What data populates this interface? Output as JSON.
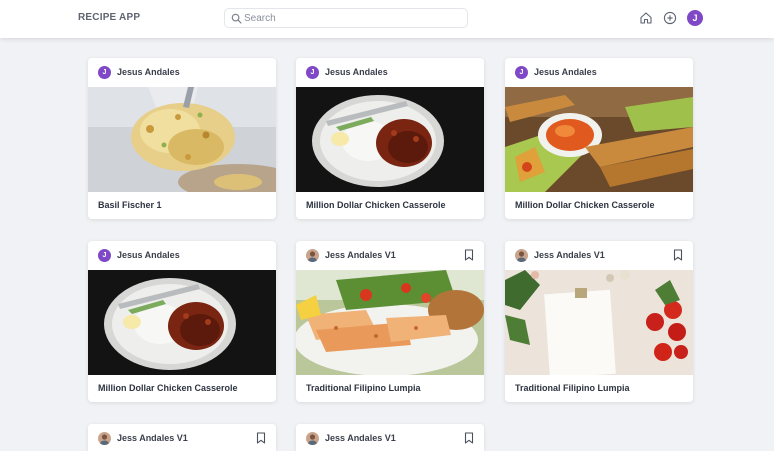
{
  "app": {
    "title": "RECIPE APP"
  },
  "search": {
    "placeholder": "Search",
    "value": ""
  },
  "nav": {
    "icons": [
      "home-icon",
      "add-circle-icon"
    ],
    "user_initial": "J"
  },
  "colors": {
    "accent": "#7f48c7",
    "background": "#f1f2f5",
    "card": "#ffffff",
    "text": "#2d3440"
  },
  "cards": [
    {
      "author": "Jesus Andales",
      "initial": "J",
      "title": "Basil Fischer 1",
      "bookmark": false,
      "image": "casserole-spoon"
    },
    {
      "author": "Jesus Andales",
      "initial": "J",
      "title": "Million Dollar Chicken Casserole",
      "bookmark": false,
      "image": "chicken-rice-plate"
    },
    {
      "author": "Jesus Andales",
      "initial": "J",
      "title": "Million Dollar Chicken Casserole",
      "bookmark": false,
      "image": "spring-rolls-dip"
    },
    {
      "author": "Jesus Andales",
      "initial": "J",
      "title": "Million Dollar Chicken Casserole",
      "bookmark": false,
      "image": "chicken-rice-plate"
    },
    {
      "author": "Jess Andales V1",
      "initial": "",
      "title": "Traditional Filipino Lumpia",
      "bookmark": true,
      "image": "shrimp-salad-plate"
    },
    {
      "author": "Jess Andales V1",
      "initial": "",
      "title": "Traditional Filipino Lumpia",
      "bookmark": true,
      "image": "notepad-tomatoes"
    },
    {
      "author": "Jess Andales V1",
      "initial": "",
      "title": "",
      "bookmark": true,
      "image": ""
    },
    {
      "author": "Jess Andales V1",
      "initial": "",
      "title": "",
      "bookmark": true,
      "image": ""
    }
  ]
}
